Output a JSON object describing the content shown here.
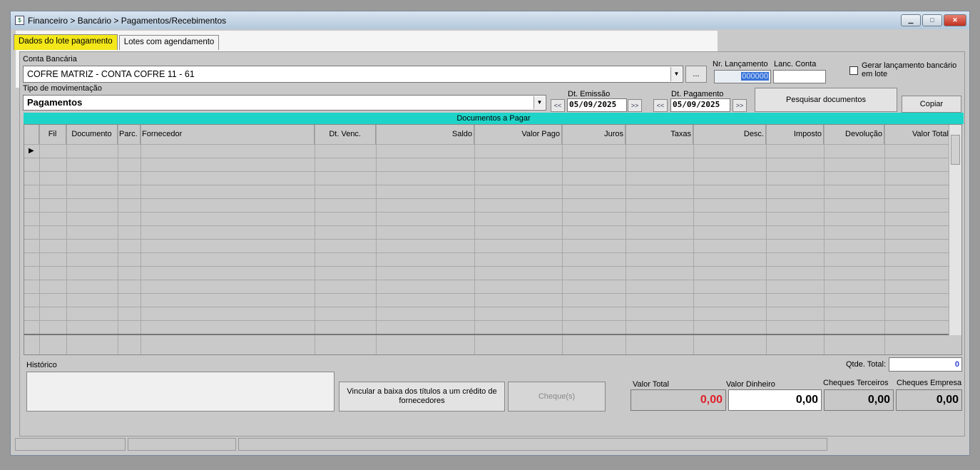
{
  "window": {
    "title": "Financeiro > Bancário > Pagamentos/Recebimentos"
  },
  "tabs": [
    {
      "label": "Dados do lote pagamento"
    },
    {
      "label": "Lotes com agendamento"
    }
  ],
  "conta": {
    "label": "Conta Bancária",
    "value": "COFRE MATRIZ - CONTA COFRE 11 - 61",
    "lookup_label": "..."
  },
  "lancamento": {
    "nr_label": "Nr. Lançamento",
    "nr_value": "000000",
    "conta_label": "Lanc. Conta",
    "conta_value": "",
    "gerar_label_1": "Gerar lançamento bancário",
    "gerar_label_2": "em lote"
  },
  "tipo": {
    "label": "Tipo de movimentação",
    "value": "Pagamentos"
  },
  "emissao": {
    "label": "Dt. Emissão",
    "value": "05/09/2025",
    "prev": "<<",
    "next": ">>"
  },
  "pagamento": {
    "label": "Dt. Pagamento",
    "value": "05/09/2025",
    "prev": "<<",
    "next": ">>"
  },
  "buttons": {
    "pesquisar": "Pesquisar documentos",
    "copiar": "Copiar",
    "vincular": "Vincular a baixa dos títulos a um crédito de fornecedores",
    "cheques": "Cheque(s)"
  },
  "grid": {
    "title": "Documentos a Pagar",
    "columns": [
      "Fil",
      "Documento",
      "Parc.",
      "Fornecedor",
      "Dt. Venc.",
      "Saldo",
      "Valor Pago",
      "Juros",
      "Taxas",
      "Desc.",
      "Imposto",
      "Devolução",
      "Valor Total"
    ],
    "row_indicator": "▶"
  },
  "historico": {
    "label": "Histórico"
  },
  "totals": {
    "qtde_label": "Qtde. Total:",
    "qtde_value": "0",
    "valor_total_label": "Valor Total",
    "valor_total": "0,00",
    "valor_dinheiro_label": "Valor Dinheiro",
    "valor_dinheiro": "0,00",
    "cheques_terceiros_label": "Cheques Terceiros",
    "cheques_terceiros": "0,00",
    "cheques_empresa_label": "Cheques Empresa",
    "cheques_empresa": "0,00"
  },
  "colors": {
    "tab_active": "#f3e71a",
    "grid_title_bg": "#1ed4c8",
    "valor_total_text": "#e0202a"
  }
}
